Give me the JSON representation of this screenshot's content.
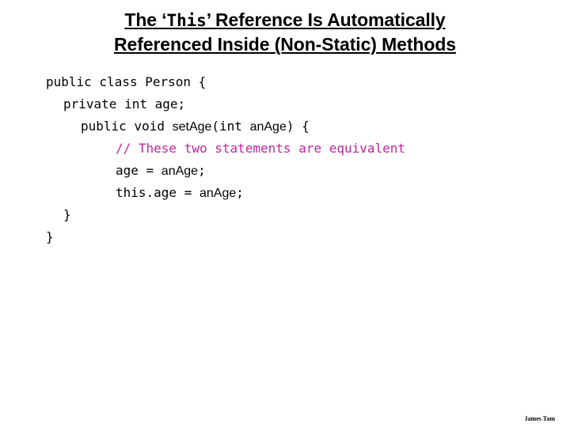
{
  "slide": {
    "background_color": "#FFFFFF",
    "title": {
      "line1_part1": "The ‘",
      "line1_mono": "This",
      "line1_part2": "’ Reference Is Automatically",
      "line2": "Referenced Inside (Non-Static) Methods"
    },
    "code": {
      "language": "java",
      "comment_color": "#C0259E",
      "text_color": "#000000",
      "lines": [
        {
          "indent": 0,
          "segments": [
            {
              "kind": "mono",
              "text": "public class Person {"
            }
          ]
        },
        {
          "indent": 1,
          "segments": [
            {
              "kind": "mono",
              "text": "private int age;"
            }
          ]
        },
        {
          "indent": 2,
          "segments": [
            {
              "kind": "mono",
              "text": "public void "
            },
            {
              "kind": "ident",
              "text": "setAge"
            },
            {
              "kind": "mono",
              "text": "(int "
            },
            {
              "kind": "ident",
              "text": "anAge"
            },
            {
              "kind": "mono",
              "text": ") {"
            }
          ]
        },
        {
          "indent": 4,
          "segments": [
            {
              "kind": "comment",
              "text": "// These two statements are equivalent"
            }
          ]
        },
        {
          "indent": 4,
          "segments": [
            {
              "kind": "mono",
              "text": "age = "
            },
            {
              "kind": "ident",
              "text": "anAge"
            },
            {
              "kind": "mono",
              "text": ";"
            }
          ]
        },
        {
          "indent": 4,
          "segments": [
            {
              "kind": "mono",
              "text": "this.age = "
            },
            {
              "kind": "ident",
              "text": "anAge"
            },
            {
              "kind": "mono",
              "text": ";"
            }
          ]
        },
        {
          "indent": 1,
          "segments": [
            {
              "kind": "mono",
              "text": "}"
            }
          ]
        },
        {
          "indent": 0,
          "segments": [
            {
              "kind": "mono",
              "text": "}"
            }
          ]
        }
      ]
    },
    "signature": "James Tam"
  }
}
